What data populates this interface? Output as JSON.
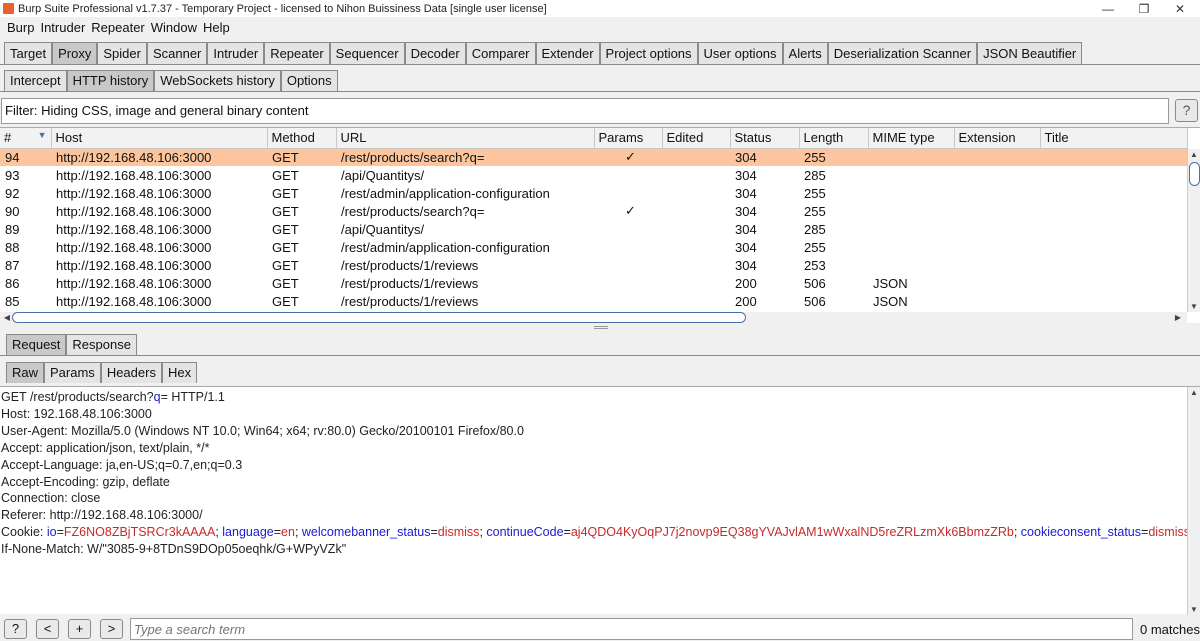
{
  "window": {
    "title": "Burp Suite Professional v1.7.37 - Temporary Project - licensed to Nihon Buissiness Data [single user license]",
    "controls": [
      "—",
      "❐",
      "✕"
    ]
  },
  "menu": [
    "Burp",
    "Intruder",
    "Repeater",
    "Window",
    "Help"
  ],
  "main_tabs": [
    "Target",
    "Proxy",
    "Spider",
    "Scanner",
    "Intruder",
    "Repeater",
    "Sequencer",
    "Decoder",
    "Comparer",
    "Extender",
    "Project options",
    "User options",
    "Alerts",
    "Deserialization Scanner",
    "JSON Beautifier"
  ],
  "main_tab_active": "Proxy",
  "proxy_tabs": [
    "Intercept",
    "HTTP history",
    "WebSockets history",
    "Options"
  ],
  "proxy_tab_active": "HTTP history",
  "filter": {
    "text": "Filter: Hiding CSS, image and general binary content",
    "help": "?"
  },
  "history": {
    "columns": [
      "#",
      "Host",
      "Method",
      "URL",
      "Params",
      "Edited",
      "Status",
      "Length",
      "MIME type",
      "Extension",
      "Title"
    ],
    "sort_indicator": "▼",
    "rows": [
      {
        "id": "94",
        "host": "http://192.168.48.106:3000",
        "method": "GET",
        "url": "/rest/products/search?q=",
        "params": "✓",
        "edited": "",
        "status": "304",
        "length": "255",
        "mime": "",
        "ext": "",
        "title": "",
        "selected": true
      },
      {
        "id": "93",
        "host": "http://192.168.48.106:3000",
        "method": "GET",
        "url": "/api/Quantitys/",
        "params": "",
        "edited": "",
        "status": "304",
        "length": "285",
        "mime": "",
        "ext": "",
        "title": ""
      },
      {
        "id": "92",
        "host": "http://192.168.48.106:3000",
        "method": "GET",
        "url": "/rest/admin/application-configuration",
        "params": "",
        "edited": "",
        "status": "304",
        "length": "255",
        "mime": "",
        "ext": "",
        "title": ""
      },
      {
        "id": "90",
        "host": "http://192.168.48.106:3000",
        "method": "GET",
        "url": "/rest/products/search?q=",
        "params": "✓",
        "edited": "",
        "status": "304",
        "length": "255",
        "mime": "",
        "ext": "",
        "title": ""
      },
      {
        "id": "89",
        "host": "http://192.168.48.106:3000",
        "method": "GET",
        "url": "/api/Quantitys/",
        "params": "",
        "edited": "",
        "status": "304",
        "length": "285",
        "mime": "",
        "ext": "",
        "title": ""
      },
      {
        "id": "88",
        "host": "http://192.168.48.106:3000",
        "method": "GET",
        "url": "/rest/admin/application-configuration",
        "params": "",
        "edited": "",
        "status": "304",
        "length": "255",
        "mime": "",
        "ext": "",
        "title": ""
      },
      {
        "id": "87",
        "host": "http://192.168.48.106:3000",
        "method": "GET",
        "url": "/rest/products/1/reviews",
        "params": "",
        "edited": "",
        "status": "304",
        "length": "253",
        "mime": "",
        "ext": "",
        "title": ""
      },
      {
        "id": "86",
        "host": "http://192.168.48.106:3000",
        "method": "GET",
        "url": "/rest/products/1/reviews",
        "params": "",
        "edited": "",
        "status": "200",
        "length": "506",
        "mime": "JSON",
        "ext": "",
        "title": ""
      },
      {
        "id": "85",
        "host": "http://192.168.48.106:3000",
        "method": "GET",
        "url": "/rest/products/1/reviews",
        "params": "",
        "edited": "",
        "status": "200",
        "length": "506",
        "mime": "JSON",
        "ext": "",
        "title": ""
      }
    ]
  },
  "message_tabs": [
    "Request",
    "Response"
  ],
  "message_tab_active": "Request",
  "view_tabs": [
    "Raw",
    "Params",
    "Headers",
    "Hex"
  ],
  "view_tab_active": "Raw",
  "request": {
    "line1_pre": "GET /rest/products/search?",
    "line1_param": "q",
    "line1_post": "= HTTP/1.1",
    "headers": [
      "Host: 192.168.48.106:3000",
      "User-Agent: Mozilla/5.0 (Windows NT 10.0; Win64; x64; rv:80.0) Gecko/20100101 Firefox/80.0",
      "Accept: application/json, text/plain, */*",
      "Accept-Language: ja,en-US;q=0.7,en;q=0.3",
      "Accept-Encoding: gzip, deflate",
      "Connection: close",
      "Referer: http://192.168.48.106:3000/"
    ],
    "cookie_label": "Cookie: ",
    "cookies": [
      {
        "name": "io",
        "value": "FZ6NO8ZBjTSRCr3kAAAA"
      },
      {
        "name": "language",
        "value": "en"
      },
      {
        "name": "welcomebanner_status",
        "value": "dismiss"
      },
      {
        "name": "continueCode",
        "value": "aj4QDO4KyOqPJ7j2novp9EQ38gYVAJvlAM1wWxalND5reZRLzmXk6BbmzZRb"
      },
      {
        "name": "cookieconsent_status",
        "value": "dismiss"
      }
    ],
    "if_none_match": "If-None-Match: W/\"3085-9+8TDnS9DOp05oeqhk/G+WPyVZk\""
  },
  "search": {
    "help": "?",
    "prev": "<",
    "add": "+",
    "next": ">",
    "placeholder": "Type a search term",
    "matches": "0 matches"
  }
}
